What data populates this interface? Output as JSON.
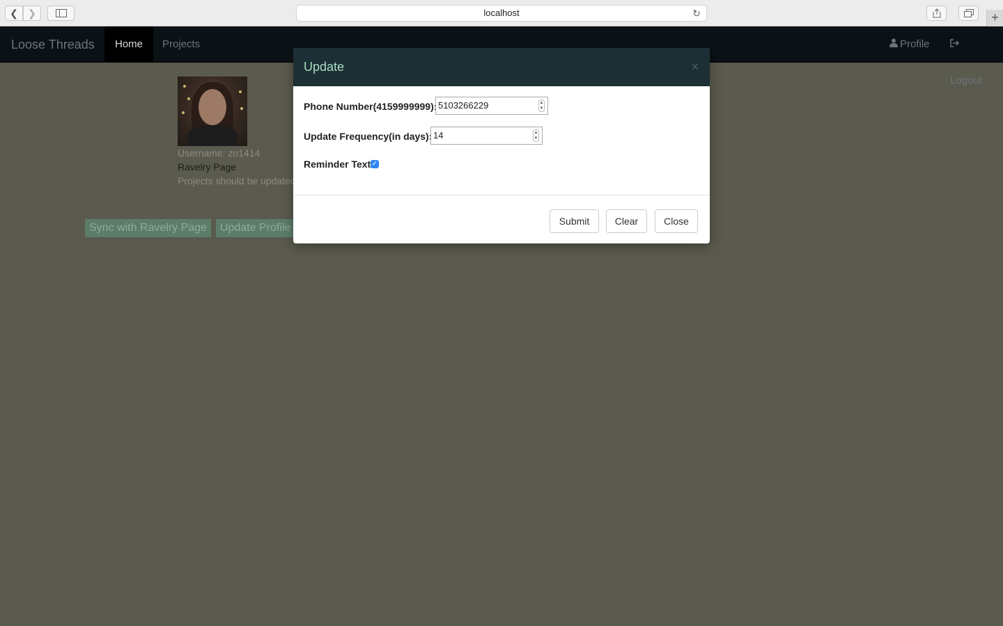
{
  "browser": {
    "url": "localhost"
  },
  "navbar": {
    "brand": "Loose Threads",
    "items": [
      {
        "label": "Home",
        "active": true
      },
      {
        "label": "Projects",
        "active": false
      }
    ],
    "right_items": [
      {
        "label": "Profile",
        "icon": "user-icon"
      },
      {
        "label": "Logout",
        "icon": "logout-icon"
      }
    ]
  },
  "profile": {
    "username": "Username: zo1414",
    "ravelry_link": "Ravelry Page",
    "projects_note": "Projects should be updated",
    "buttons": {
      "sync": "Sync with Ravelry Page",
      "update": "Update Profile"
    }
  },
  "modal": {
    "title": "Update",
    "close_symbol": "×",
    "phone": {
      "label": "Phone Number(4159999999):",
      "value": "5103266229"
    },
    "frequency": {
      "label": "Update Frequency(in days):",
      "value": "14"
    },
    "reminder": {
      "label": "Reminder Text",
      "checked": true
    },
    "footer": {
      "submit": "Submit",
      "clear": "Clear",
      "close": "Close"
    }
  },
  "colors": {
    "overlay_bg": "#5a5a4e",
    "navbar_bg": "#0b1216",
    "modal_header_bg": "#1c2f35",
    "modal_title": "#a8dcc0",
    "checkbox": "#2f86f6"
  }
}
